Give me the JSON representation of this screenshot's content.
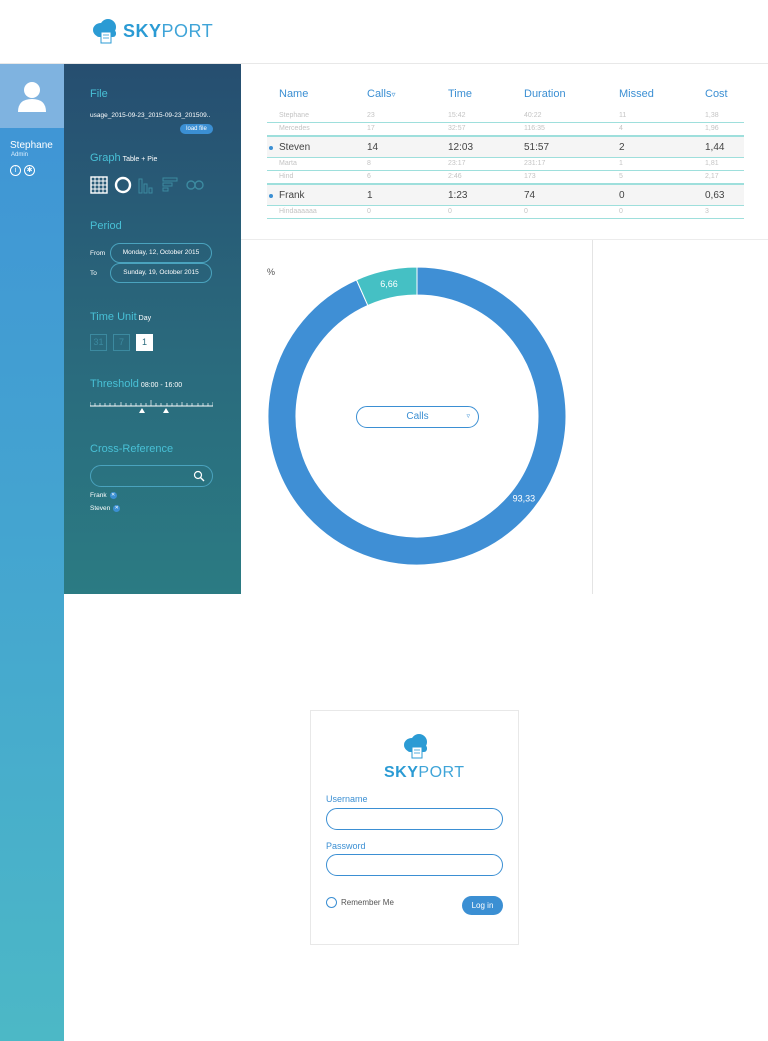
{
  "brand": {
    "sky": "SKY",
    "port": "PORT",
    "accent": "#2b9bd4"
  },
  "user": {
    "name": "Stephane",
    "role": "Admin",
    "icons": [
      "info-icon",
      "gear-icon"
    ]
  },
  "panel": {
    "file": {
      "title": "File",
      "filename": "usage_2015-09-23_2015-09-23_201509..",
      "load_label": "load file"
    },
    "graph": {
      "title": "Graph",
      "subtitle": "Table + Pie",
      "options": [
        "table-icon",
        "donut-icon",
        "bar-chart-icon",
        "horizontal-bar-icon",
        "infinity-icon"
      ]
    },
    "period": {
      "title": "Period",
      "from_label": "From",
      "from_value": "Monday, 12, October 2015",
      "to_label": "To",
      "to_value": "Sunday, 19, October 2015"
    },
    "time_unit": {
      "title": "Time Unit",
      "subtitle": "Day",
      "options": [
        "31",
        "7",
        "1"
      ],
      "selected": "1"
    },
    "threshold": {
      "title": "Threshold",
      "subtitle": "08:00 - 16:00"
    },
    "cross_reference": {
      "title": "Cross-Reference",
      "search_placeholder": "",
      "items": [
        "Frank",
        "Steven"
      ]
    }
  },
  "table": {
    "headers": {
      "name": "Name",
      "calls": "Calls",
      "time": "Time",
      "duration": "Duration",
      "missed": "Missed",
      "cost": "Cost"
    },
    "sort_indicator": "▿",
    "rows": [
      {
        "name": "Stephane",
        "calls": "23",
        "time": "15:42",
        "duration": "40:22",
        "missed": "11",
        "cost": "1,38",
        "selected": false
      },
      {
        "name": "Mercedes",
        "calls": "17",
        "time": "32:57",
        "duration": "116:35",
        "missed": "4",
        "cost": "1,96",
        "selected": false
      },
      {
        "name": "Steven",
        "calls": "14",
        "time": "12:03",
        "duration": "51:57",
        "missed": "2",
        "cost": "1,44",
        "selected": true
      },
      {
        "name": "Marta",
        "calls": "8",
        "time": "23:17",
        "duration": "231:17",
        "missed": "1",
        "cost": "1,81",
        "selected": false
      },
      {
        "name": "Hind",
        "calls": "6",
        "time": "2:46",
        "duration": "173",
        "missed": "5",
        "cost": "2,17",
        "selected": false
      },
      {
        "name": "Frank",
        "calls": "1",
        "time": "1:23",
        "duration": "74",
        "missed": "0",
        "cost": "0,63",
        "selected": true
      },
      {
        "name": "Hindaaaaaa",
        "calls": "0",
        "time": "0",
        "duration": "0",
        "missed": "0",
        "cost": "3",
        "selected": false
      }
    ]
  },
  "chart_data": {
    "type": "pie",
    "ylabel": "%",
    "slices": [
      {
        "label": "93,33",
        "value": 93.33,
        "color": "#3f8fd5"
      },
      {
        "label": "6,66",
        "value": 6.66,
        "color": "#45c0c4"
      }
    ],
    "selector": "Calls"
  },
  "login": {
    "username_label": "Username",
    "username_value": "",
    "password_label": "Password",
    "password_value": "",
    "remember_label": "Remember Me",
    "button_label": "Log in"
  }
}
